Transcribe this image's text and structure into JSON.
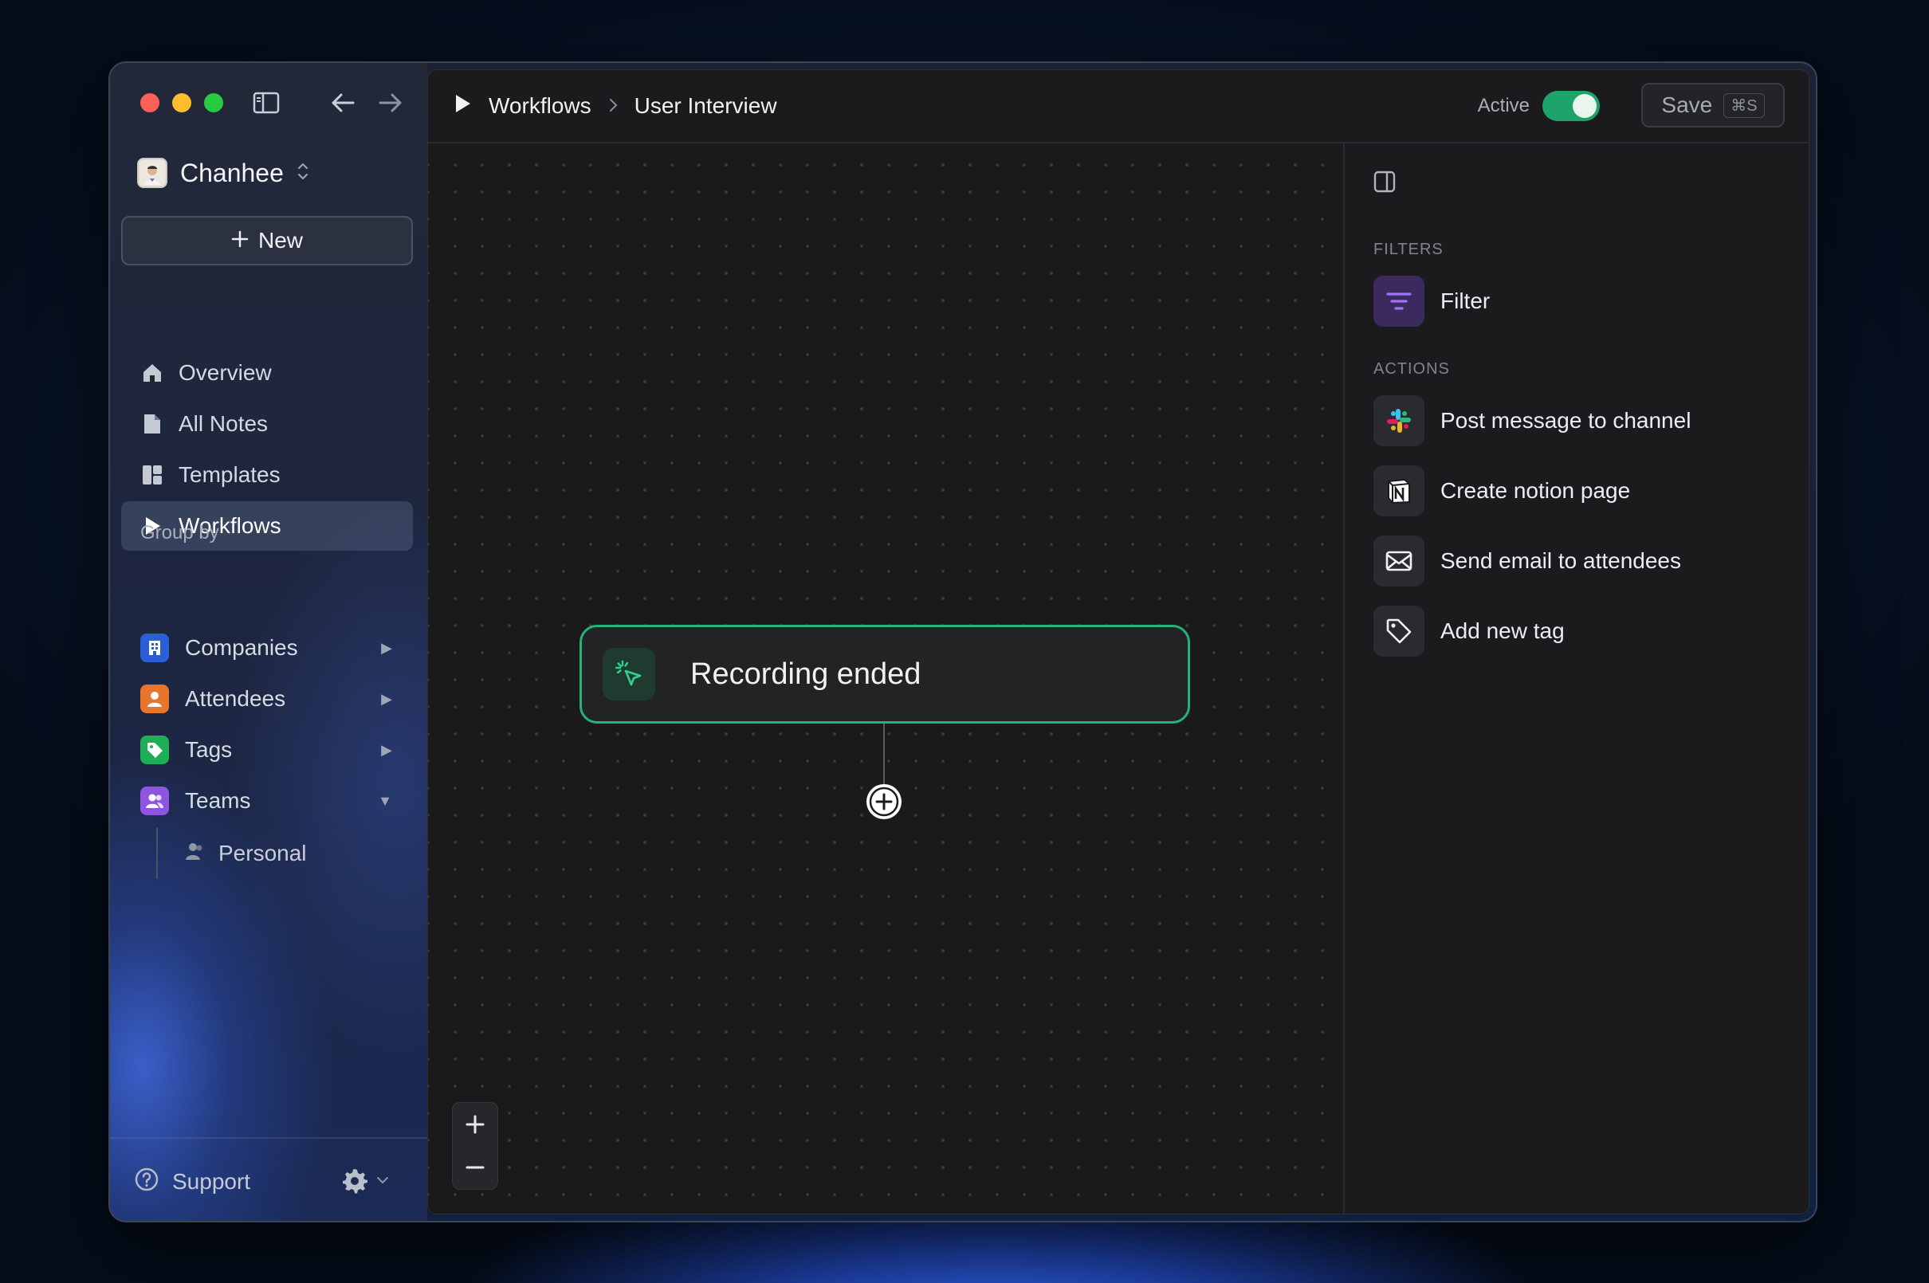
{
  "sidebar": {
    "account_name": "Chanhee",
    "new_label": "New",
    "nav": [
      {
        "label": "Overview"
      },
      {
        "label": "All Notes"
      },
      {
        "label": "Templates"
      },
      {
        "label": "Workflows"
      }
    ],
    "group_by_title": "Group by",
    "groups": [
      {
        "label": "Companies",
        "expanded": false
      },
      {
        "label": "Attendees",
        "expanded": false
      },
      {
        "label": "Tags",
        "expanded": false
      },
      {
        "label": "Teams",
        "expanded": true
      }
    ],
    "team_children": [
      {
        "label": "Personal"
      }
    ],
    "support_label": "Support"
  },
  "header": {
    "breadcrumb_root": "Workflows",
    "breadcrumb_current": "User Interview",
    "active_label": "Active",
    "active_on": true,
    "save_label": "Save",
    "save_shortcut": "⌘S"
  },
  "canvas": {
    "trigger_label": "Recording ended"
  },
  "panel": {
    "filters_title": "FILTERS",
    "filters": [
      {
        "label": "Filter",
        "icon": "filter-icon"
      }
    ],
    "actions_title": "ACTIONS",
    "actions": [
      {
        "label": "Post message to channel",
        "icon": "slack-icon"
      },
      {
        "label": "Create notion page",
        "icon": "notion-icon"
      },
      {
        "label": "Send email to attendees",
        "icon": "mail-icon"
      },
      {
        "label": "Add new tag",
        "icon": "tag-icon"
      }
    ]
  },
  "colors": {
    "accent_green": "#22b476",
    "toggle_on": "#1ea36a",
    "filter_purple": "#8b5cf6"
  }
}
